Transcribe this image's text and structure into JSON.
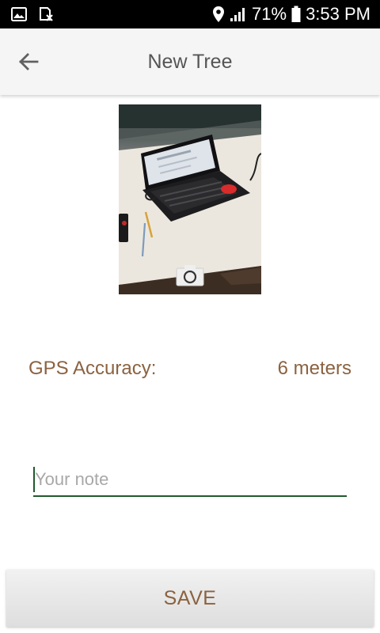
{
  "status_bar": {
    "battery_text": "71%",
    "time": "3:53 PM",
    "icons": [
      "image-icon",
      "sd-card-x-icon",
      "location-icon",
      "signal-icon",
      "battery-icon"
    ]
  },
  "app_bar": {
    "title": "New Tree",
    "back_icon": "arrow-left-icon"
  },
  "photo": {
    "camera_icon": "camera-icon"
  },
  "gps": {
    "label": "GPS Accuracy:",
    "value": "6 meters"
  },
  "note": {
    "placeholder": "Your note",
    "value": ""
  },
  "actions": {
    "save_label": "SAVE"
  },
  "colors": {
    "accent_brown": "#8b6240",
    "input_underline": "#1f5a2b",
    "app_bar_bg": "#f5f5f5",
    "status_bar_bg": "#000000"
  }
}
